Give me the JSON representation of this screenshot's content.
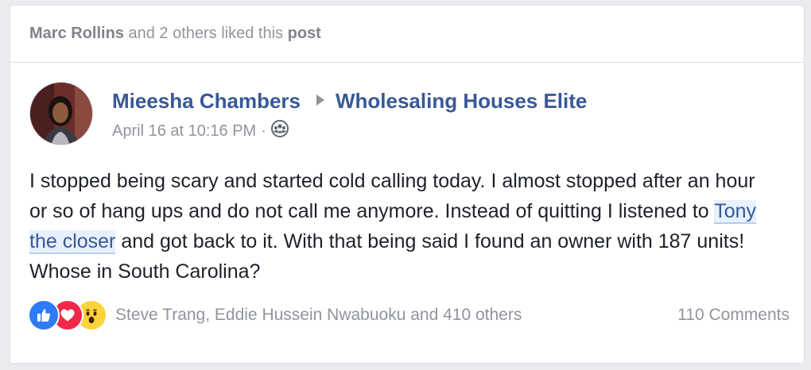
{
  "liked_bar": {
    "names": "Marc Rollins",
    "middle": " and 2 others liked this ",
    "post": "post"
  },
  "post": {
    "author": "Mieesha Chambers",
    "group": "Wholesaling Houses Elite",
    "timestamp": "April 16 at 10:16 PM",
    "separator": "·",
    "audience_icon": "group-icon",
    "text_before": "I stopped being scary and started cold calling today. I almost stopped after an hour or so of hang ups and do not call me anymore. Instead of quitting I listened to ",
    "mention": "Tony the closer",
    "text_after": " and got back to it. With that being said I found an owner with 187 units! Whose in South Carolina?"
  },
  "reactions": {
    "icons": [
      "like-icon",
      "love-icon",
      "wow-icon"
    ],
    "summary": "Steve Trang, Eddie Hussein Nwabuoku and 410 others",
    "comments": "110 Comments"
  },
  "colors": {
    "link": "#385898",
    "muted": "#90949c",
    "text": "#1d2129",
    "like": "#2e7bf6",
    "love": "#f0284a",
    "wow": "#fdd33b"
  }
}
